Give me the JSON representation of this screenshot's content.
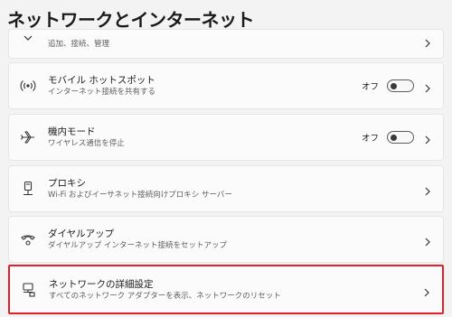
{
  "page": {
    "title": "ネットワークとインターネット"
  },
  "items": [
    {
      "title": "",
      "desc": "追加、接続、管理",
      "icon": "vpn-shield-icon"
    },
    {
      "title": "モバイル ホットスポット",
      "desc": "インターネット接続を共有する",
      "icon": "hotspot-icon",
      "toggle": {
        "label": "オフ",
        "on": false
      }
    },
    {
      "title": "機内モード",
      "desc": "ワイヤレス通信を停止",
      "icon": "airplane-icon",
      "toggle": {
        "label": "オフ",
        "on": false
      }
    },
    {
      "title": "プロキシ",
      "desc": "Wi-Fi およびイーサネット接続向けプロキシ サーバー",
      "icon": "proxy-server-icon"
    },
    {
      "title": "ダイヤルアップ",
      "desc": "ダイヤルアップ インターネット接続をセットアップ",
      "icon": "dialup-icon"
    },
    {
      "title": "ネットワークの詳細設定",
      "desc": "すべてのネットワーク アダプターを表示、ネットワークのリセット",
      "icon": "advanced-network-icon"
    }
  ],
  "colors": {
    "highlight": "#e0212b",
    "background": "#f3f3f3",
    "card": "#fbfbfb"
  }
}
